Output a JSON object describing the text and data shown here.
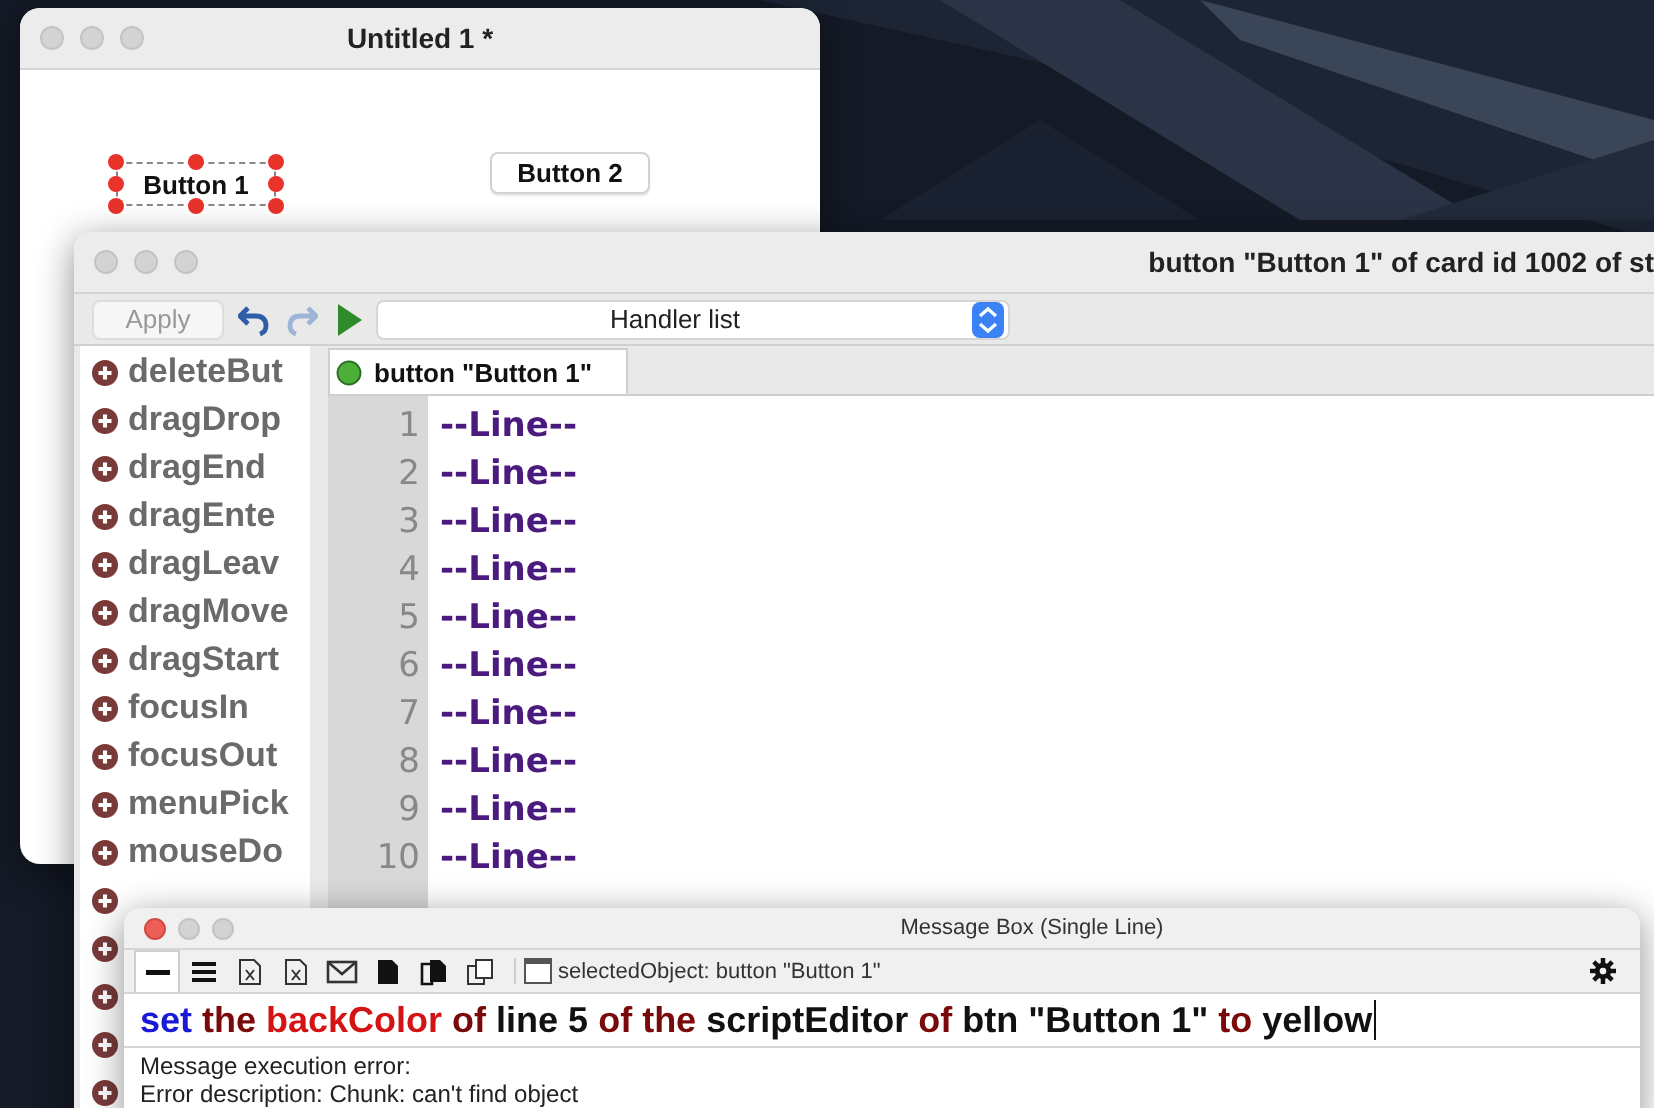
{
  "card_window": {
    "title": "Untitled 1 *",
    "buttons": [
      {
        "label": "Button 1",
        "selected": true
      },
      {
        "label": "Button 2",
        "selected": false
      }
    ]
  },
  "script_editor": {
    "title": "button \"Button 1\" of card id 1002 of st",
    "apply": {
      "label": "Apply",
      "disabled": true
    },
    "handler_menu": "Handler list",
    "handlers": [
      {
        "label": "deleteBut"
      },
      {
        "label": "dragDrop"
      },
      {
        "label": "dragEnd"
      },
      {
        "label": "dragEnte"
      },
      {
        "label": "dragLeav"
      },
      {
        "label": "dragMove"
      },
      {
        "label": "dragStart"
      },
      {
        "label": "focusIn"
      },
      {
        "label": "focusOut"
      },
      {
        "label": "menuPick"
      },
      {
        "label": "mouseDo"
      }
    ],
    "tab": "button \"Button 1\"",
    "lines": [
      {
        "number": "1",
        "code": "--Line--"
      },
      {
        "number": "2",
        "code": "--Line--"
      },
      {
        "number": "3",
        "code": "--Line--"
      },
      {
        "number": "4",
        "code": "--Line--"
      },
      {
        "number": "5",
        "code": "--Line--"
      },
      {
        "number": "6",
        "code": "--Line--"
      },
      {
        "number": "7",
        "code": "--Line--"
      },
      {
        "number": "8",
        "code": "--Line--"
      },
      {
        "number": "9",
        "code": "--Line--"
      },
      {
        "number": "10",
        "code": "--Line--"
      }
    ]
  },
  "message_box": {
    "title": "Message Box (Single Line)",
    "tools": [
      {
        "kind": "single-line",
        "selected": true
      },
      {
        "kind": "multi-line",
        "selected": false
      },
      {
        "kind": "document",
        "selected": false
      },
      {
        "kind": "document",
        "selected": false
      },
      {
        "kind": "envelope",
        "selected": false
      },
      {
        "kind": "page",
        "selected": false
      },
      {
        "kind": "pages",
        "selected": false
      },
      {
        "kind": "copy",
        "selected": false
      }
    ],
    "selected_object": "selectedObject: button \"Button 1\"",
    "command": [
      {
        "text": "set",
        "color": "#1a1ad6"
      },
      {
        "text": "the",
        "color": "#7a0a0a"
      },
      {
        "text": "backColor",
        "color": "#d41414"
      },
      {
        "text": "of",
        "color": "#7a0a0a"
      },
      {
        "text": "line 5",
        "color": "#111111"
      },
      {
        "text": "of the",
        "color": "#7a0a0a"
      },
      {
        "text": "scriptEditor",
        "color": "#111111"
      },
      {
        "text": "of",
        "color": "#7a0a0a"
      },
      {
        "text": "btn \"Button 1\"",
        "color": "#111111"
      },
      {
        "text": "to",
        "color": "#7a0a0a"
      },
      {
        "text": "yellow",
        "color": "#111111"
      }
    ],
    "output": [
      "Message execution error:",
      "Error description: Chunk: can't find object"
    ]
  }
}
